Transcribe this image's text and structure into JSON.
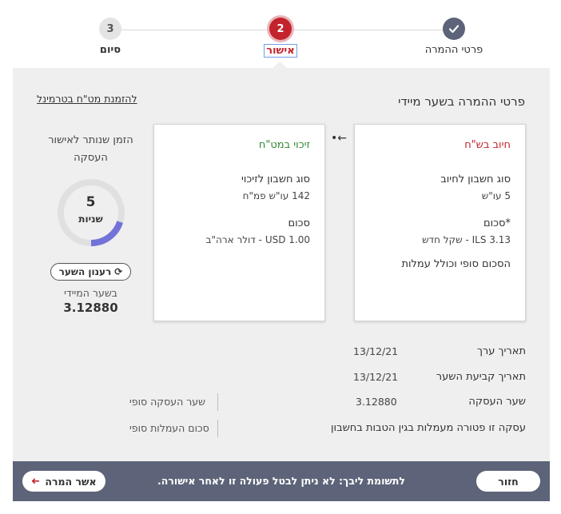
{
  "stepper": {
    "steps": [
      {
        "number": "",
        "label": "פרטי ההמרה",
        "state": "done"
      },
      {
        "number": "2",
        "label": "אישור",
        "state": "active"
      },
      {
        "number": "3",
        "label": "סיום",
        "state": "pending"
      }
    ]
  },
  "main": {
    "title": "פרטי ההמרה בשער מיידי",
    "terminal_link": "להזמנת מט\"ח בטרמינל",
    "debit_card": {
      "title": "חיוב בש\"ח",
      "account_type_label": "סוג חשבון לחיוב",
      "account_type_value": "5 עו\"ש",
      "amount_label": "*סכום",
      "amount_value": "ILS 3.13 - שקל חדש",
      "note": "הסכום סופי וכולל עמלות"
    },
    "credit_card": {
      "title": "זיכוי במט\"ח",
      "account_type_label": "סוג חשבון לזיכוי",
      "account_type_value": "142 עו\"ש פמ\"ח",
      "amount_label": "סכום",
      "amount_value": "USD 1.00 - דולר ארה\"ב"
    },
    "timer": {
      "title": "הזמן שנותר לאישור העסקה",
      "value": "5",
      "unit": "שניות",
      "progress_fraction": 0.2,
      "refresh_label": "רענון השער",
      "rate_label": "בשער המיידי",
      "rate_value": "3.12880"
    },
    "details": {
      "value_date_label": "תאריך ערך",
      "value_date": "13/12/21",
      "rate_date_label": "תאריך קביעת השער",
      "rate_date": "13/12/21",
      "rate_label": "שער העסקה",
      "rate_value": "3.12880",
      "rate_side_label": "שער העסקה סופי",
      "fee_label": "עסקה זו פטורה מעמלות בגין הטבות בחשבון",
      "fee_side_label": "סכום העמלות סופי"
    }
  },
  "footer": {
    "back_label": "חזור",
    "note": "לתשומת ליבך: לא ניתן לבטל פעולה זו לאחר אישורה.",
    "approve_label": "אשר המרה"
  },
  "colors": {
    "accent": "#c3232c",
    "credit_green": "#2c8a2c",
    "footer_bg": "#5d6479",
    "panel_bg": "#eeefee"
  }
}
